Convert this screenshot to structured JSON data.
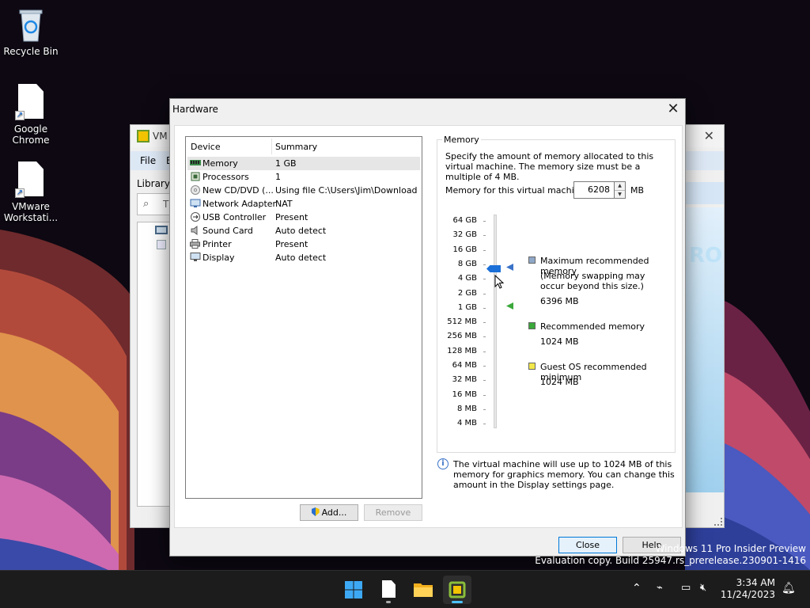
{
  "desktop": {
    "icons": [
      {
        "label": "Recycle Bin"
      },
      {
        "label": "Google\nChrome"
      },
      {
        "label": "VMware\nWorkstati..."
      }
    ]
  },
  "background_window": {
    "title": "VM",
    "menu": [
      "File",
      "E"
    ],
    "library_label": "Library",
    "search_partial": "T",
    "banner_partial": "RO"
  },
  "dialog": {
    "title": "Hardware",
    "device_list": {
      "headers": {
        "device": "Device",
        "summary": "Summary"
      },
      "rows": [
        {
          "icon": "memory-icon",
          "device": "Memory",
          "summary": "1 GB",
          "selected": true
        },
        {
          "icon": "processor-icon",
          "device": "Processors",
          "summary": "1"
        },
        {
          "icon": "cd-dvd-icon",
          "device": "New CD/DVD (...",
          "summary": "Using file C:\\Users\\Jim\\Downloads..."
        },
        {
          "icon": "network-adapter-icon",
          "device": "Network Adapter",
          "summary": "NAT"
        },
        {
          "icon": "usb-icon",
          "device": "USB Controller",
          "summary": "Present"
        },
        {
          "icon": "sound-icon",
          "device": "Sound Card",
          "summary": "Auto detect"
        },
        {
          "icon": "printer-icon",
          "device": "Printer",
          "summary": "Present"
        },
        {
          "icon": "display-icon",
          "device": "Display",
          "summary": "Auto detect"
        }
      ]
    },
    "buttons": {
      "add": "Add...",
      "remove": "Remove",
      "close": "Close",
      "help": "Help"
    },
    "memory": {
      "group_title": "Memory",
      "description": "Specify the amount of memory allocated to this virtual machine. The memory size must be a multiple of 4 MB.",
      "field_label": "Memory for this virtual machine:",
      "value": "6208",
      "unit": "MB",
      "scale": [
        "64 GB",
        "32 GB",
        "16 GB",
        "8 GB",
        "4 GB",
        "2 GB",
        "1 GB",
        "512 MB",
        "256 MB",
        "128 MB",
        "64 MB",
        "32 MB",
        "16 MB",
        "8 MB",
        "4 MB"
      ],
      "legend": {
        "max": {
          "label": "Maximum recommended memory",
          "note": "(Memory swapping may occur beyond this size.)",
          "value": "6396 MB",
          "color": "#8fa8c8"
        },
        "recommended": {
          "label": "Recommended memory",
          "value": "1024 MB",
          "color": "#3aa83a"
        },
        "guest_min": {
          "label": "Guest OS recommended minimum",
          "value": "1024 MB",
          "color": "#f2e84a"
        }
      },
      "info_text": "The virtual machine will use up to 1024 MB of this memory for graphics memory. You can change this amount in the Display settings page."
    }
  },
  "watermark": {
    "line1": "Windows 11 Pro Insider Preview",
    "line2": "Evaluation copy. Build 25947.rs_prerelease.230901-1416"
  },
  "taskbar": {
    "time": "3:34 AM",
    "date": "11/24/2023"
  },
  "colors": {
    "accent": "#0078d7",
    "slider_thumb": "#1b6fd8"
  }
}
